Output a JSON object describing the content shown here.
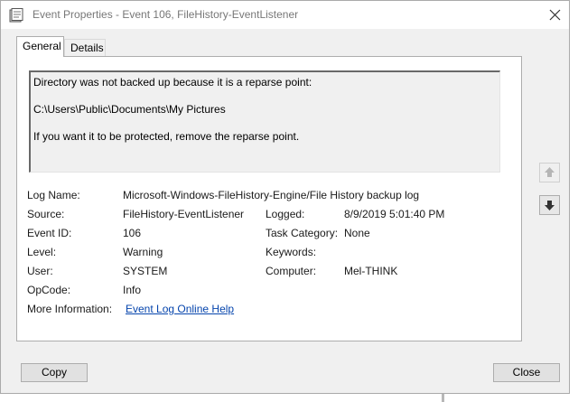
{
  "window": {
    "title": "Event Properties - Event 106, FileHistory-EventListener"
  },
  "tabs": [
    {
      "label": "General",
      "active": true
    },
    {
      "label": "Details",
      "active": false
    }
  ],
  "message": {
    "line1": "Directory was not backed up because it is a reparse point:",
    "line2": "C:\\Users\\Public\\Documents\\My Pictures",
    "line3": "If you want it to be protected, remove the reparse point."
  },
  "fields": {
    "log_name_label": "Log Name:",
    "log_name_value": "Microsoft-Windows-FileHistory-Engine/File History backup log",
    "source_label": "Source:",
    "source_value": "FileHistory-EventListener",
    "logged_label": "Logged:",
    "logged_value": "8/9/2019 5:01:40 PM",
    "event_id_label": "Event ID:",
    "event_id_value": "106",
    "task_category_label": "Task Category:",
    "task_category_value": "None",
    "level_label": "Level:",
    "level_value": "Warning",
    "keywords_label": "Keywords:",
    "keywords_value": "",
    "user_label": "User:",
    "user_value": "SYSTEM",
    "computer_label": "Computer:",
    "computer_value": "Mel-THINK",
    "opcode_label": "OpCode:",
    "opcode_value": "Info",
    "more_info_label": "More Information:",
    "more_info_link": "Event Log Online Help"
  },
  "side_buttons": {
    "up_icon": "arrow-up-icon",
    "down_icon": "arrow-down-icon"
  },
  "buttons": {
    "copy": "Copy",
    "close": "Close"
  },
  "colors": {
    "link": "#0645ad",
    "window_bg": "#f0f0f0"
  }
}
